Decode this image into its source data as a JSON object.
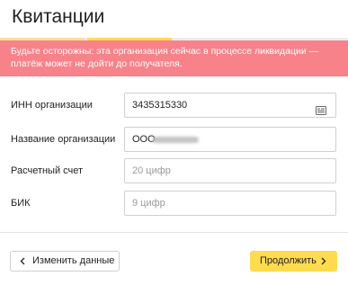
{
  "header": {
    "title": "Квитанции"
  },
  "progress": {
    "filled_fraction": 0.49,
    "colors": {
      "segment1": "#ffdb4d",
      "segment2": "#ffdb4d",
      "track": "#ececec"
    }
  },
  "warning": {
    "text": "Будьте осторожны: эта организация сейчас в процессе ликвидации — платёж может не дойти до получателя.",
    "background": "#f8828a"
  },
  "form": {
    "inn": {
      "label": "ИНН организации",
      "value": "3435315330",
      "icon": "card-icon"
    },
    "org_name": {
      "label": "Название организации",
      "value": "ООО"
    },
    "account": {
      "label": "Расчетный счет",
      "placeholder": "20 цифр"
    },
    "bik": {
      "label": "БИК",
      "placeholder": "9 цифр"
    }
  },
  "actions": {
    "back_label": "Изменить данные",
    "next_label": "Продолжить",
    "next_color": "#ffdb4d"
  }
}
